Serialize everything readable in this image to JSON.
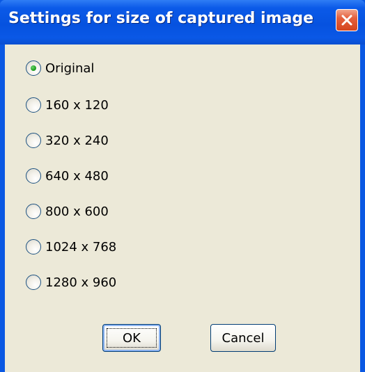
{
  "window": {
    "title": "Settings for size of captured image"
  },
  "options": [
    {
      "label": "Original",
      "selected": true
    },
    {
      "label": "160 x 120",
      "selected": false
    },
    {
      "label": "320 x 240",
      "selected": false
    },
    {
      "label": "640 x 480",
      "selected": false
    },
    {
      "label": "800 x 600",
      "selected": false
    },
    {
      "label": "1024 x 768",
      "selected": false
    },
    {
      "label": "1280 x 960",
      "selected": false
    }
  ],
  "buttons": {
    "ok": "OK",
    "cancel": "Cancel"
  },
  "colors": {
    "titlebar": "#0a58e3",
    "client_background": "#ece9d8",
    "close_button": "#e0532e",
    "radio_selected_dot": "#21a121"
  },
  "icons": {
    "close": "close-icon"
  }
}
